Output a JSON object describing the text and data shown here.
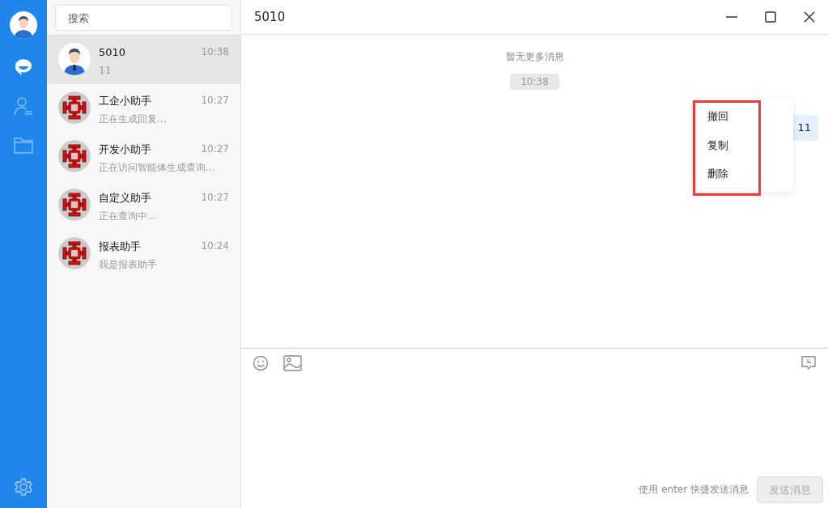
{
  "sidebar": {
    "items": [
      {
        "kind": "chat",
        "selected": true
      },
      {
        "kind": "contacts",
        "selected": false
      },
      {
        "kind": "files",
        "selected": false
      }
    ]
  },
  "search": {
    "placeholder": "搜索"
  },
  "conversations": [
    {
      "name": "5010",
      "time": "10:38",
      "preview": "11",
      "kind": "person",
      "selected": true
    },
    {
      "name": "工企小助手",
      "time": "10:27",
      "preview": "正在生成回复...",
      "kind": "bot",
      "selected": false
    },
    {
      "name": "开发小助手",
      "time": "10:27",
      "preview": "正在访问智能体生成查询...",
      "kind": "bot",
      "selected": false
    },
    {
      "name": "自定义助手",
      "time": "10:27",
      "preview": "正在查询中...",
      "kind": "bot",
      "selected": false
    },
    {
      "name": "报表助手",
      "time": "10:24",
      "preview": "我是报表助手",
      "kind": "bot",
      "selected": false
    }
  ],
  "chat": {
    "title": "5010",
    "notice": "暂无更多消息",
    "timestamp": "10:38",
    "messages": [
      {
        "text": "11",
        "outgoing": true
      }
    ]
  },
  "context_menu": {
    "items": [
      "撤回",
      "复制",
      "删除"
    ],
    "highlighted": true
  },
  "composer": {
    "hint": "使用 enter 快捷发送消息",
    "send_button": {
      "label": "发送消息",
      "disabled": true
    }
  }
}
